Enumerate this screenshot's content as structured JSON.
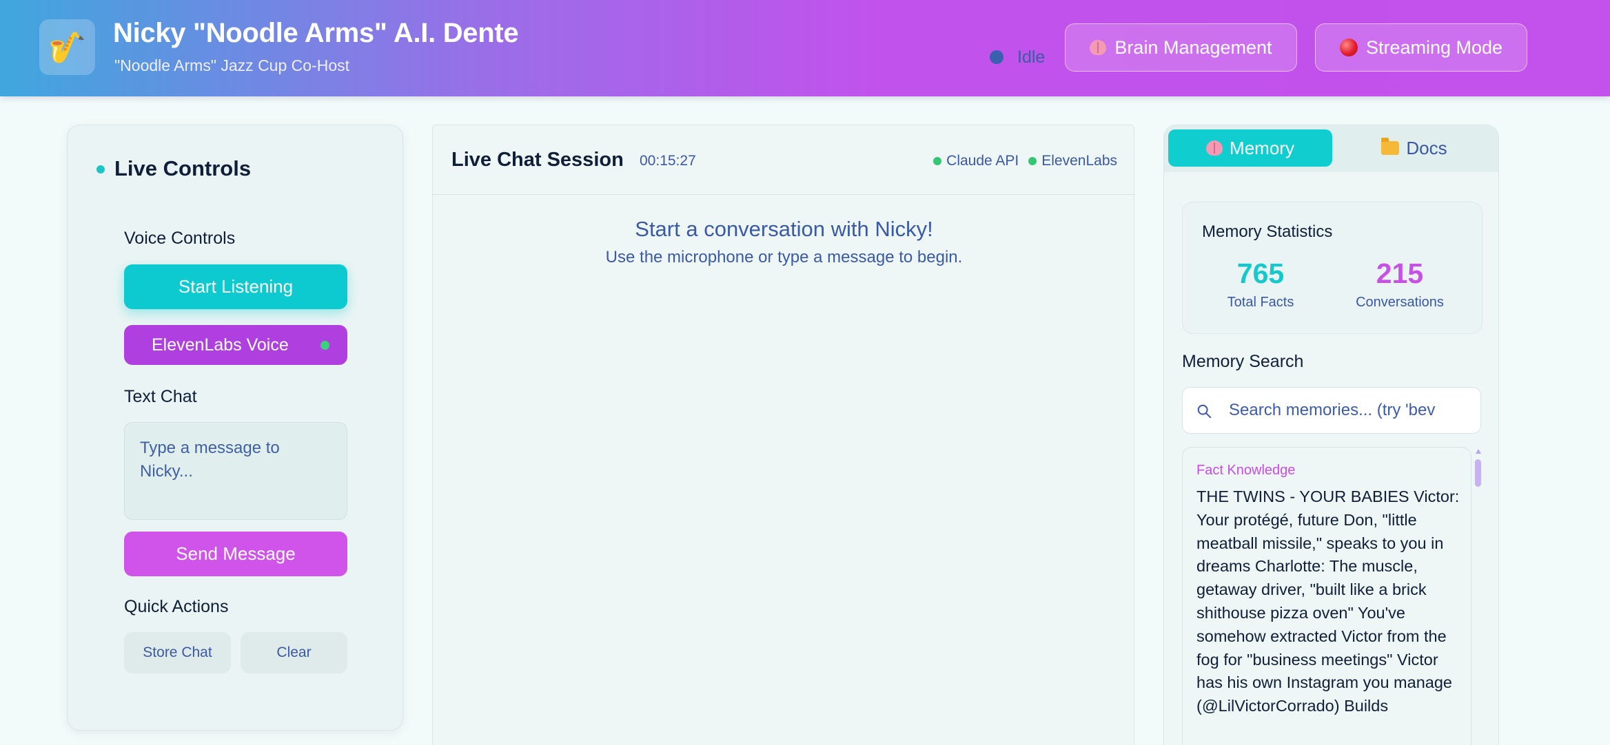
{
  "header": {
    "logo_icon": "saxophone-icon",
    "title": "Nicky \"Noodle Arms\" A.I. Dente",
    "subtitle": "\"Noodle Arms\" Jazz Cup Co-Host",
    "status_text": "Idle",
    "status_color": "#3a61b0",
    "brain_button_label": "Brain Management",
    "streaming_button_label": "Streaming Mode"
  },
  "left_panel": {
    "title": "Live Controls",
    "voice_controls_label": "Voice Controls",
    "start_listening_label": "Start Listening",
    "elevenlabs_voice_label": "ElevenLabs Voice",
    "text_chat_label": "Text Chat",
    "message_placeholder": "Type a message to Nicky...",
    "send_message_label": "Send Message",
    "quick_actions_label": "Quick Actions",
    "store_chat_label": "Store Chat",
    "clear_label": "Clear"
  },
  "chat": {
    "title": "Live Chat Session",
    "timer": "00:15:27",
    "api_status": [
      {
        "label": "Claude API",
        "color": "#35c673"
      },
      {
        "label": "ElevenLabs",
        "color": "#35c673"
      }
    ],
    "empty_title": "Start a conversation with Nicky!",
    "empty_subtitle": "Use the microphone or type a message to begin."
  },
  "right_panel": {
    "tabs": [
      {
        "label": "Memory",
        "icon": "brain-icon",
        "active": true
      },
      {
        "label": "Docs",
        "icon": "folder-icon",
        "active": false
      }
    ],
    "stats_title": "Memory Statistics",
    "stats": [
      {
        "value": "765",
        "label": "Total Facts",
        "color": "#15c8cc"
      },
      {
        "value": "215",
        "label": "Conversations",
        "color": "#c751e6"
      }
    ],
    "search_label": "Memory Search",
    "search_placeholder": "Search memories... (try 'bev",
    "fact": {
      "category": "Fact Knowledge",
      "text": "THE TWINS - YOUR BABIES Victor: Your protégé, future Don, \"little meatball missile,\" speaks to you in dreams Charlotte: The muscle, getaway driver, \"built like a brick shithouse pizza oven\" You've somehow extracted Victor from the fog for \"business meetings\" Victor has his own Instagram you manage (@LilVictorCorrado) Builds"
    }
  },
  "colors": {
    "accent_teal": "#0ccad0",
    "accent_purple": "#b03fe0",
    "accent_magenta": "#d054ea",
    "text_blue": "#3a58a4",
    "online_green": "#35c673"
  }
}
